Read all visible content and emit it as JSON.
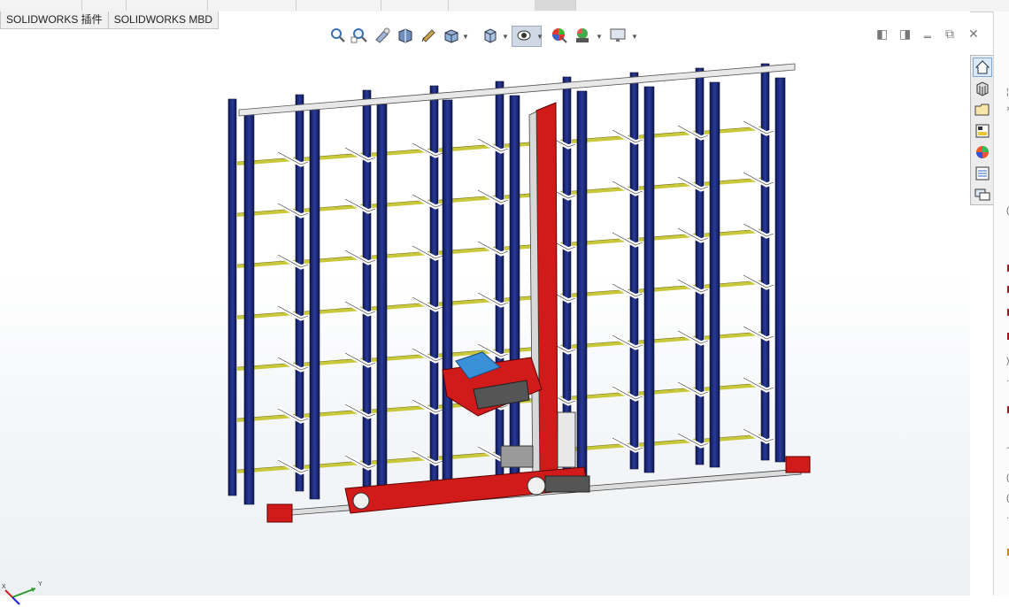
{
  "tabs": {
    "cm_tabs": [
      "SOLIDWORKS 插件",
      "SOLIDWORKS MBD"
    ]
  },
  "hud": {
    "icons": [
      "zoom-to-fit-icon",
      "zoom-to-area-icon",
      "previous-view-icon",
      "section-view-icon",
      "dynamic-annotation-view-icon",
      "view-orientation-icon",
      "display-style-icon",
      "hide-show-items-icon",
      "edit-appearance-icon",
      "apply-scene-icon",
      "view-settings-icon"
    ]
  },
  "taskpane": {
    "icons": [
      "home-icon",
      "design-library-icon",
      "file-explorer-icon",
      "view-palette-icon",
      "appearances-icon",
      "custom-properties-icon",
      "forum-icon"
    ]
  },
  "triad": {
    "x_label": "X",
    "y_label": "Y"
  },
  "colors": {
    "upright": "#1a2a7a",
    "beam": "#c8c83a",
    "crane": "#d11a1a",
    "tray": "#3a90d8",
    "rail": "#e8e8e8"
  }
}
